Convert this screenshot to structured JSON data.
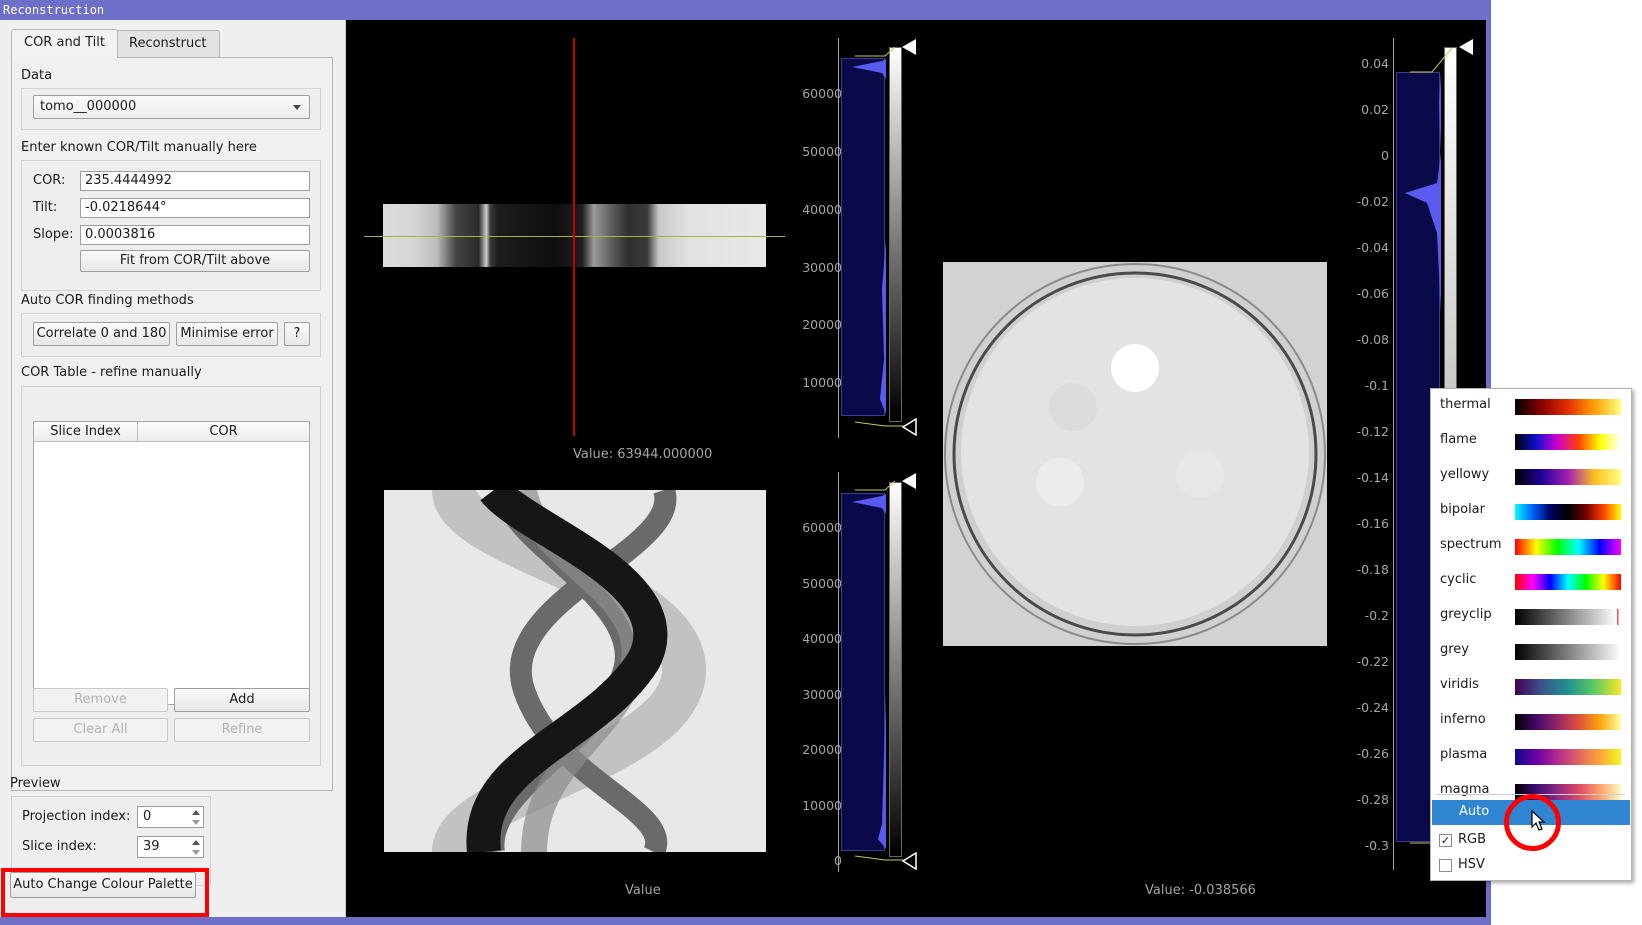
{
  "window": {
    "title": "Reconstruction"
  },
  "tabs": [
    {
      "label": "COR and Tilt",
      "active": true
    },
    {
      "label": "Reconstruct",
      "active": false
    }
  ],
  "data_section": {
    "label": "Data",
    "selected": "tomo__000000"
  },
  "manual_section": {
    "label": "Enter known COR/Tilt manually here",
    "cor_label": "COR:",
    "cor_value": "235.4444992",
    "tilt_label": "Tilt:",
    "tilt_value": "-0.0218644°",
    "slope_label": "Slope:",
    "slope_value": "0.0003816",
    "fit_button": "Fit from COR/Tilt above"
  },
  "auto_section": {
    "label": "Auto COR finding methods",
    "correlate_button": "Correlate 0 and 180",
    "minimise_button": "Minimise error",
    "help_button": "?"
  },
  "table_section": {
    "label": "COR Table - refine manually",
    "columns": [
      "Slice Index",
      "COR"
    ],
    "rows": [],
    "remove_button": "Remove",
    "add_button": "Add",
    "clear_button": "Clear All",
    "refine_button": "Refine"
  },
  "preview": {
    "label": "Preview",
    "projection_label": "Projection index:",
    "projection_value": "0",
    "slice_label": "Slice index:",
    "slice_value": "39"
  },
  "auto_palette_button": "Auto Change Colour Palette",
  "views": {
    "projection": {
      "readout": "Value: 63944.000000",
      "axis_ticks": [
        "60000",
        "50000",
        "40000",
        "30000",
        "20000",
        "10000"
      ]
    },
    "sinogram": {
      "readout": "Value",
      "axis_ticks": [
        "60000",
        "50000",
        "40000",
        "30000",
        "20000",
        "10000",
        "0"
      ]
    },
    "reconstruction": {
      "readout": "Value: -0.038566",
      "axis_ticks": [
        "0.04",
        "0.02",
        "0",
        "-0.02",
        "-0.04",
        "-0.06",
        "-0.08",
        "-0.1",
        "-0.12",
        "-0.14",
        "-0.16",
        "-0.18",
        "-0.2",
        "-0.22",
        "-0.24",
        "-0.26",
        "-0.28",
        "-0.3"
      ]
    }
  },
  "colour_menu": {
    "palettes": [
      "thermal",
      "flame",
      "yellowy",
      "bipolar",
      "spectrum",
      "cyclic",
      "greyclip",
      "grey",
      "viridis",
      "inferno",
      "plasma",
      "magma"
    ],
    "auto_label": "Auto",
    "rgb_label": "RGB",
    "rgb_checked": true,
    "hsv_label": "HSV",
    "hsv_checked": false
  },
  "colors": {
    "title_bar": "#6d6fc8",
    "highlight": "#2f85d1",
    "annotation": "#ff0000",
    "histogram_fill": "#5a5af0"
  },
  "icons": {
    "cursor": "mouse-pointer-icon",
    "combo_arrow": "chevron-down-icon"
  }
}
